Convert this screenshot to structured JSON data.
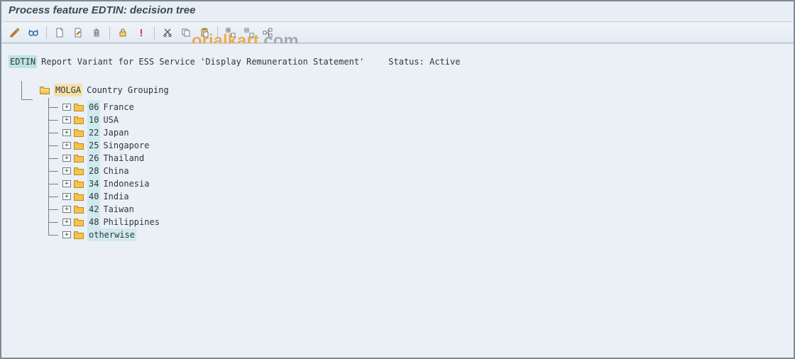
{
  "title": "Process feature EDTIN: decision tree",
  "watermark_a": "orialkart",
  "watermark_b": ".com",
  "toolbar_icons": [
    "pencil-icon",
    "glasses-icon",
    "|",
    "new-page-icon",
    "edit-page-icon",
    "trash-icon",
    "|",
    "lock-icon",
    "info-icon",
    "|",
    "cut-icon",
    "copy-icon",
    "paste-icon",
    "|",
    "expand-all-icon",
    "collapse-all-icon",
    "where-used-icon"
  ],
  "root": {
    "feature": "EDTIN",
    "description": "Report Variant for ESS Service 'Display Remuneration Statement'",
    "status_label": "Status:",
    "status_value": "Active"
  },
  "group": {
    "key": "MOLGA",
    "label": "Country Grouping"
  },
  "nodes": [
    {
      "code": "06",
      "label": "France"
    },
    {
      "code": "10",
      "label": "USA"
    },
    {
      "code": "22",
      "label": "Japan"
    },
    {
      "code": "25",
      "label": "Singapore"
    },
    {
      "code": "26",
      "label": "Thailand"
    },
    {
      "code": "28",
      "label": "China"
    },
    {
      "code": "34",
      "label": "Indonesia"
    },
    {
      "code": "40",
      "label": "India"
    },
    {
      "code": "42",
      "label": "Taiwan"
    },
    {
      "code": "48",
      "label": "Philippines"
    },
    {
      "code": "otherwise",
      "label": ""
    }
  ]
}
